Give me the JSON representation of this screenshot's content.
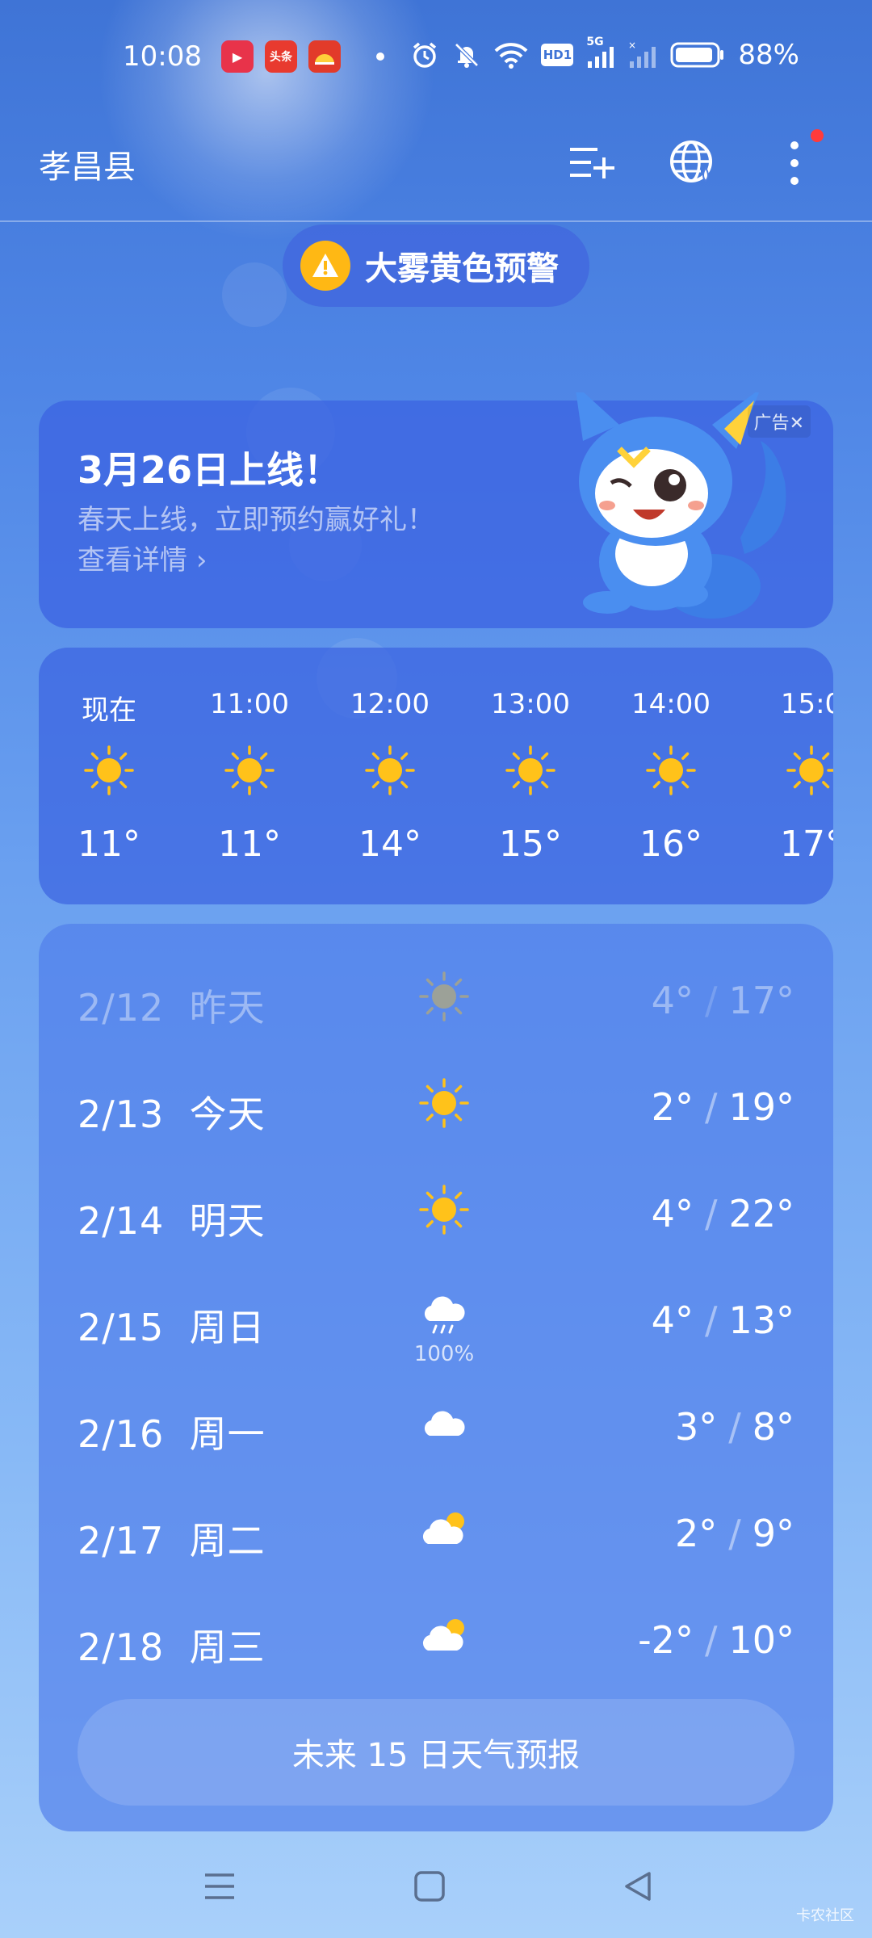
{
  "status_bar": {
    "time": "10:08",
    "apps": [
      {
        "icon": "video-app-icon",
        "color": "#e8334a",
        "text": "▶"
      },
      {
        "icon": "toutiao-app-icon",
        "color": "#e83a2f",
        "text": "头条"
      },
      {
        "icon": "news-app-icon",
        "color": "#e23b2a",
        "text": ""
      }
    ],
    "battery": "88%",
    "hd": "HD1",
    "network": "5G"
  },
  "header": {
    "city": "孝昌县"
  },
  "warning": {
    "text": "大雾黄色预警",
    "color": "#ffb814"
  },
  "ad": {
    "title": "3月26日上线！",
    "subtitle": "春天上线，立即预约赢好礼！",
    "link": "查看详情",
    "tag": "广告"
  },
  "hourly": [
    {
      "label": "现在",
      "icon": "sunny-icon",
      "temp": "11°"
    },
    {
      "label": "11:00",
      "icon": "sunny-icon",
      "temp": "11°"
    },
    {
      "label": "12:00",
      "icon": "sunny-icon",
      "temp": "14°"
    },
    {
      "label": "13:00",
      "icon": "sunny-icon",
      "temp": "15°"
    },
    {
      "label": "14:00",
      "icon": "sunny-icon",
      "temp": "16°"
    },
    {
      "label": "15:0",
      "icon": "sunny-icon",
      "temp": "17°"
    }
  ],
  "daily": [
    {
      "date": "2/12",
      "day": "昨天",
      "icon": "sunny-icon",
      "low": "4°",
      "high": "17°",
      "precip": "",
      "past": true
    },
    {
      "date": "2/13",
      "day": "今天",
      "icon": "sunny-icon",
      "low": "2°",
      "high": "19°",
      "precip": "",
      "past": false
    },
    {
      "date": "2/14",
      "day": "明天",
      "icon": "sunny-icon",
      "low": "4°",
      "high": "22°",
      "precip": "",
      "past": false
    },
    {
      "date": "2/15",
      "day": "周日",
      "icon": "rain-icon",
      "low": "4°",
      "high": "13°",
      "precip": "100%",
      "past": false
    },
    {
      "date": "2/16",
      "day": "周一",
      "icon": "cloudy-icon",
      "low": "3°",
      "high": "8°",
      "precip": "",
      "past": false
    },
    {
      "date": "2/17",
      "day": "周二",
      "icon": "partly-cloudy-icon",
      "low": "2°",
      "high": "9°",
      "precip": "",
      "past": false
    },
    {
      "date": "2/18",
      "day": "周三",
      "icon": "partly-cloudy-icon",
      "low": "-2°",
      "high": "10°",
      "precip": "",
      "past": false
    }
  ],
  "forecast_button": "未来 15 日天气预报",
  "watermark": "卡农社区",
  "colors": {
    "sun": "#ffc21a",
    "alert_dot": "#ff3b3b"
  }
}
